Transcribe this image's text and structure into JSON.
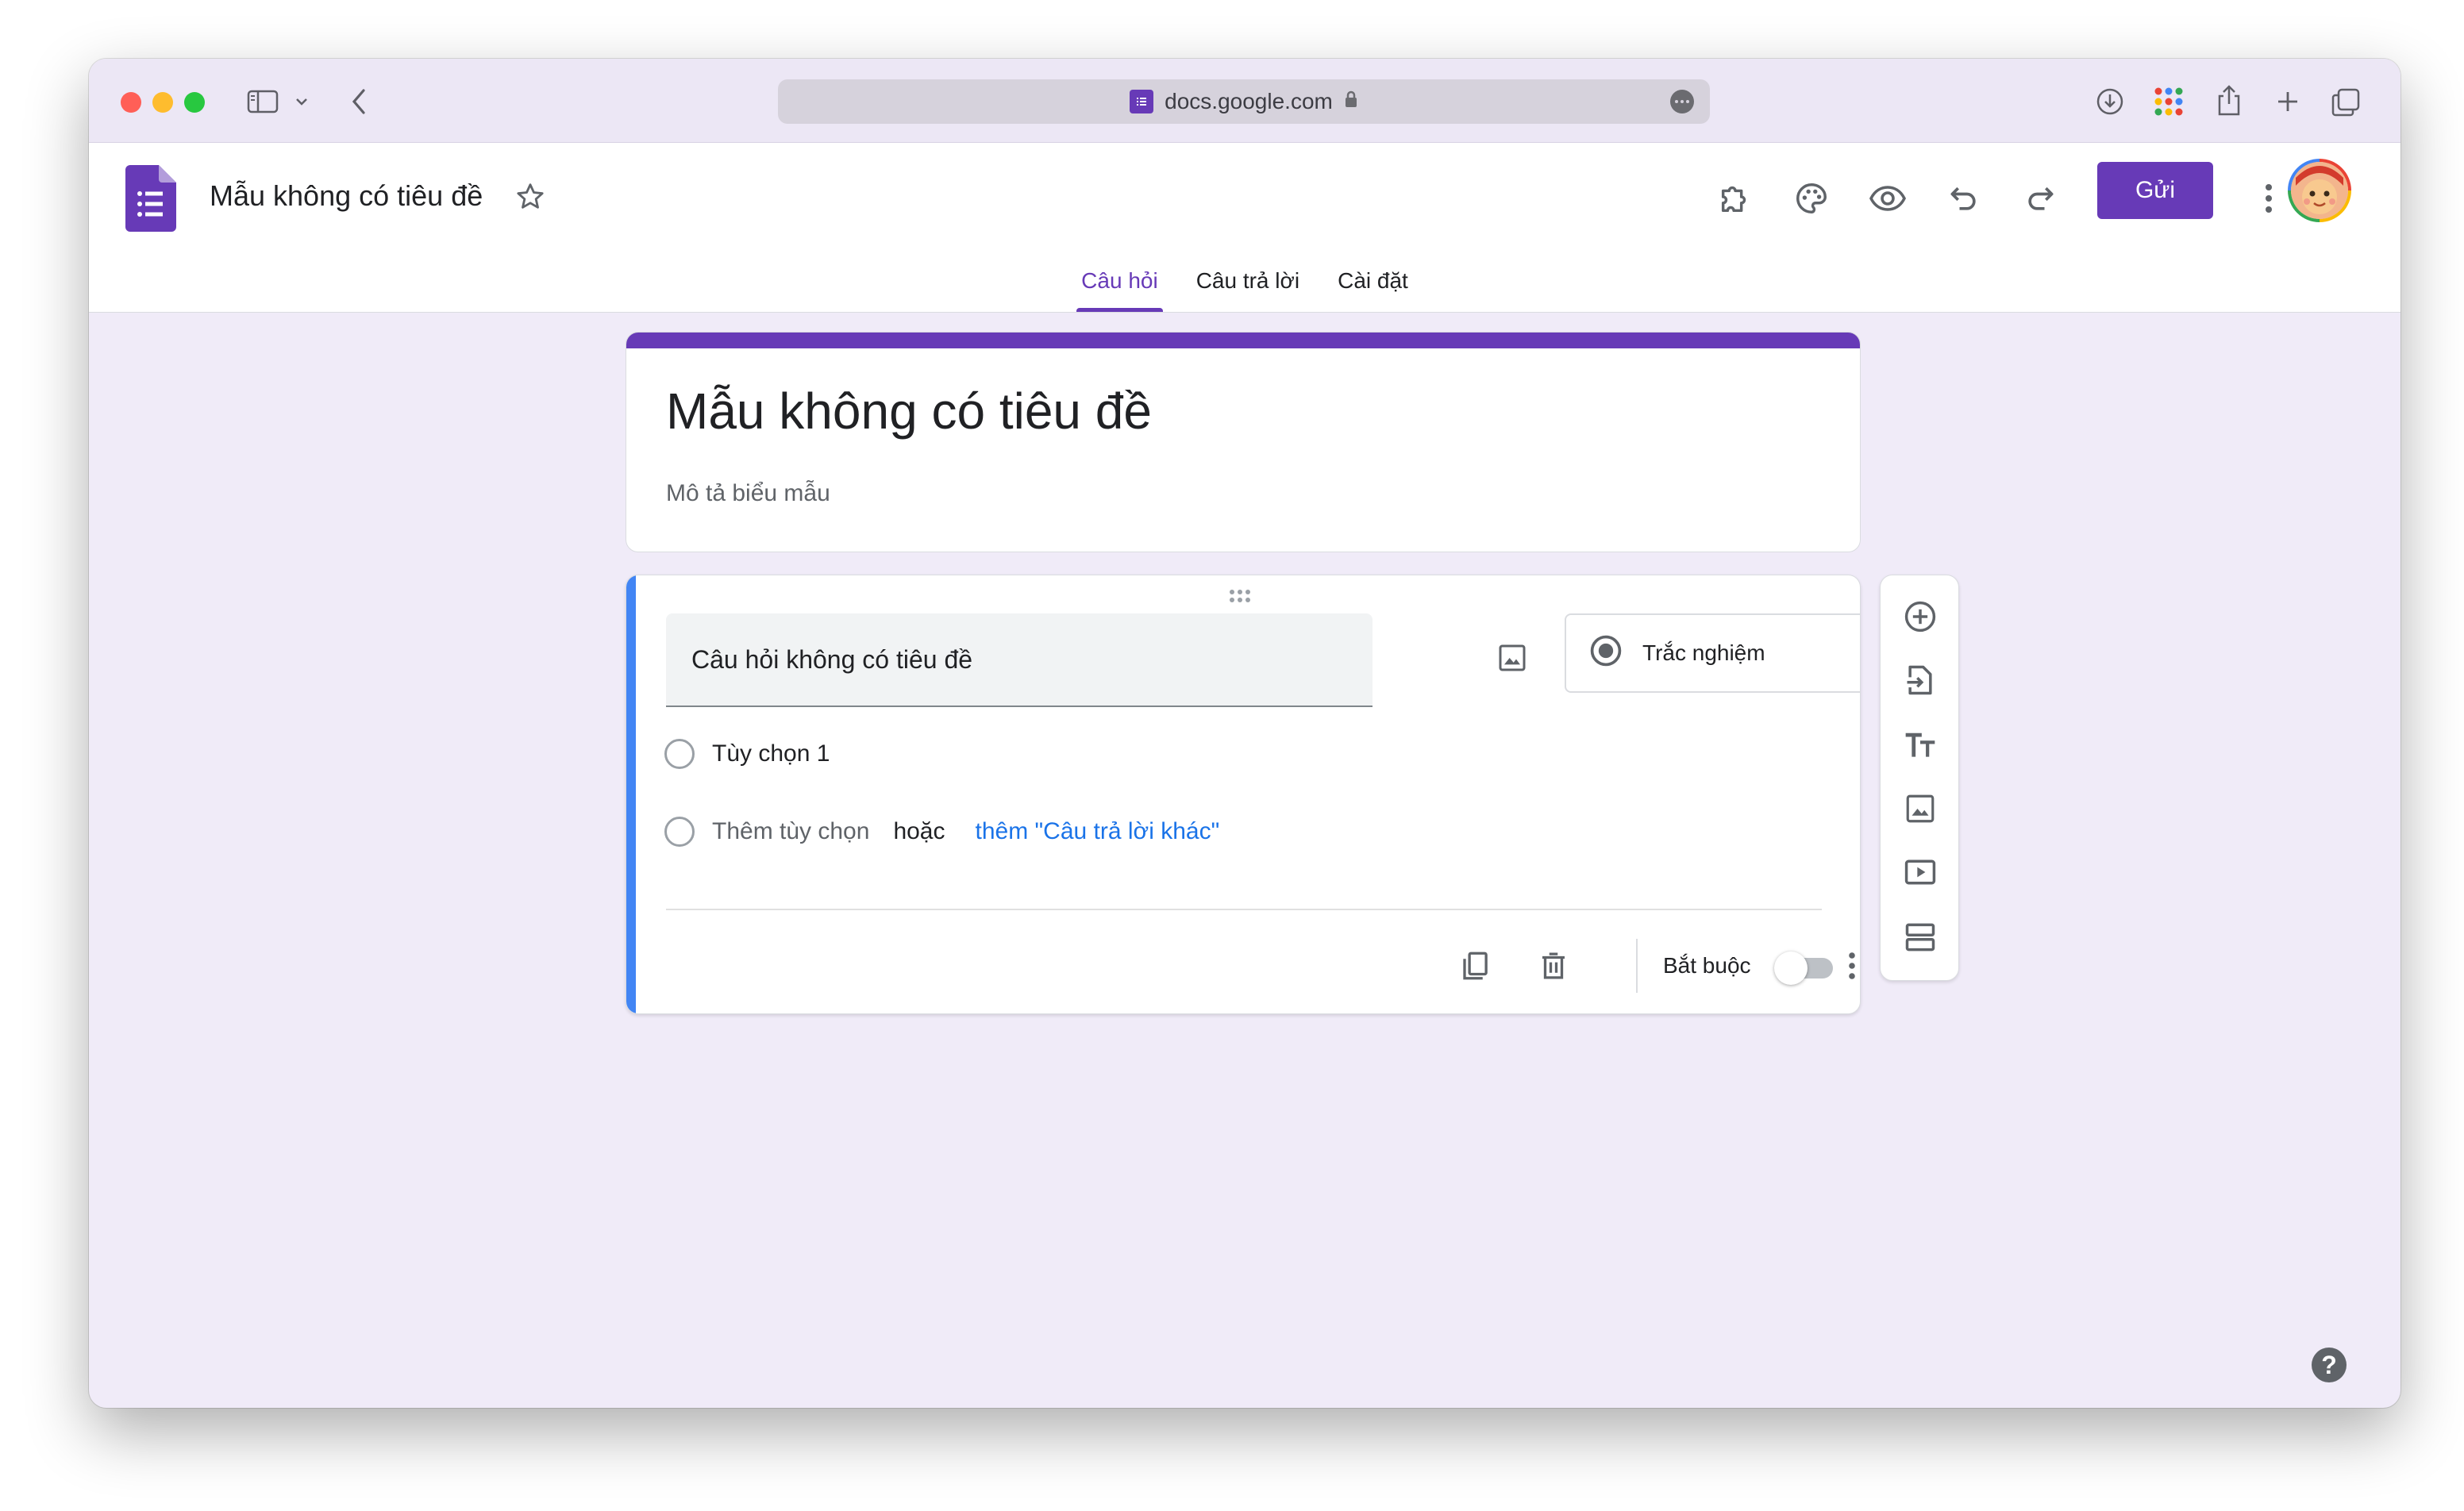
{
  "browser": {
    "url": "docs.google.com",
    "toolbar_icons": [
      "sidebar-icon",
      "chevron-down-icon",
      "back-icon",
      "download-icon",
      "apps-grid-icon",
      "share-icon",
      "new-tab-icon",
      "tabs-overview-icon"
    ]
  },
  "header": {
    "doc_title": "Mẫu không có tiêu đề",
    "send_label": "Gửi",
    "icons": [
      "addon-icon",
      "palette-icon",
      "preview-eye-icon",
      "undo-icon",
      "redo-icon",
      "more-vert-icon"
    ]
  },
  "tabs": [
    {
      "label": "Câu hỏi",
      "active": true
    },
    {
      "label": "Câu trả lời",
      "active": false
    },
    {
      "label": "Cài đặt",
      "active": false
    }
  ],
  "form": {
    "title": "Mẫu không có tiêu đề",
    "description_placeholder": "Mô tả biểu mẫu"
  },
  "question": {
    "title": "Câu hỏi không có tiêu đề",
    "type_label": "Trắc nghiệm",
    "option1": "Tùy chọn 1",
    "add_option": "Thêm tùy chọn",
    "or_text": "hoặc",
    "add_other": "thêm \"Câu trả lời khác\"",
    "required_label": "Bắt buộc",
    "required": false
  },
  "side_tools": [
    "add-question-icon",
    "import-questions-icon",
    "add-title-icon",
    "add-image-icon",
    "add-video-icon",
    "add-section-icon"
  ],
  "colors": {
    "accent": "#673ab7",
    "background": "#f0ebf8",
    "question_highlight": "#4285f4",
    "link": "#1a73e8"
  }
}
